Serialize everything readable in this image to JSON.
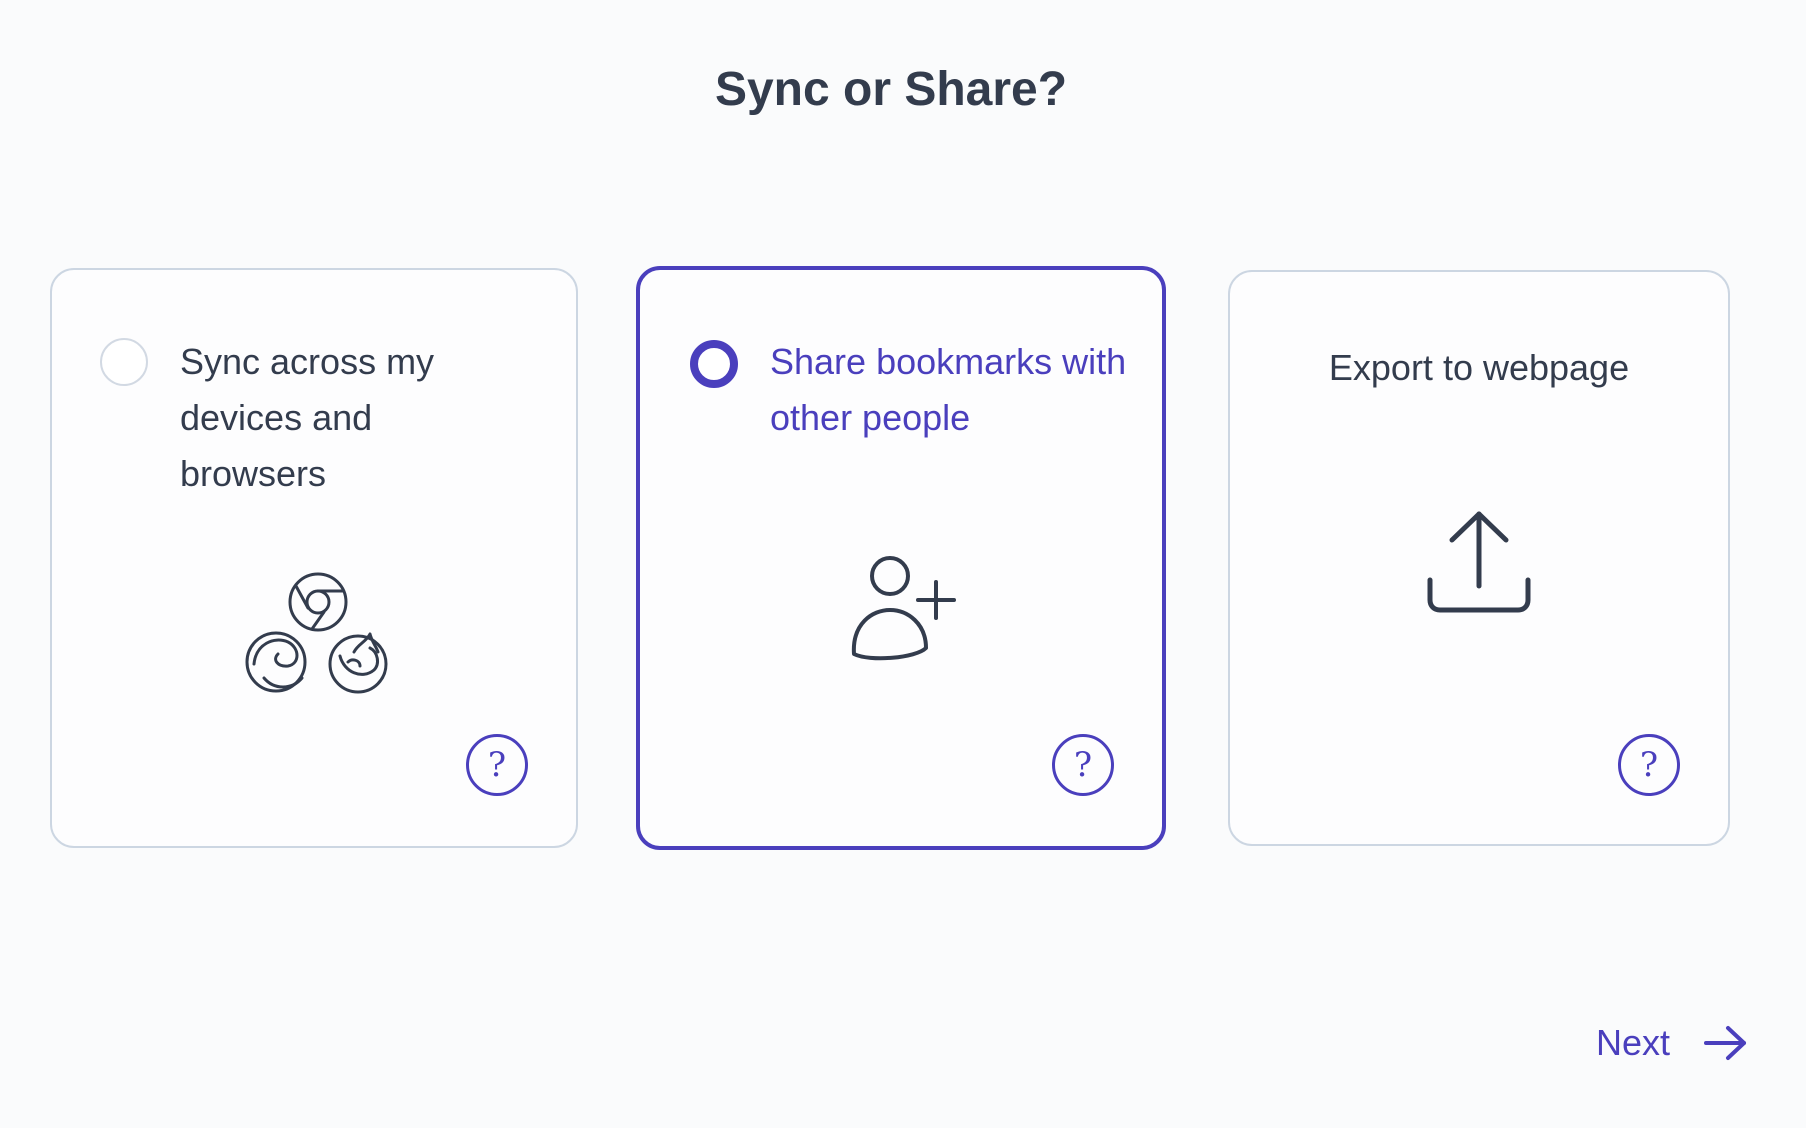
{
  "header": {
    "title": "Sync or Share?"
  },
  "options": [
    {
      "label": "Sync across my devices and browsers",
      "selected": false,
      "icon": "browsers-icon",
      "help_label": "?"
    },
    {
      "label": "Share bookmarks with other people",
      "selected": true,
      "icon": "add-person-icon",
      "help_label": "?"
    },
    {
      "label": "Export to webpage",
      "selected": false,
      "icon": "upload-icon",
      "help_label": "?"
    }
  ],
  "footer": {
    "next_label": "Next",
    "next_icon": "arrow-right-icon"
  },
  "colors": {
    "accent": "#4a3fbd",
    "text": "#333c4d",
    "card_border": "#ccd6e2",
    "background": "#fafbfc"
  }
}
